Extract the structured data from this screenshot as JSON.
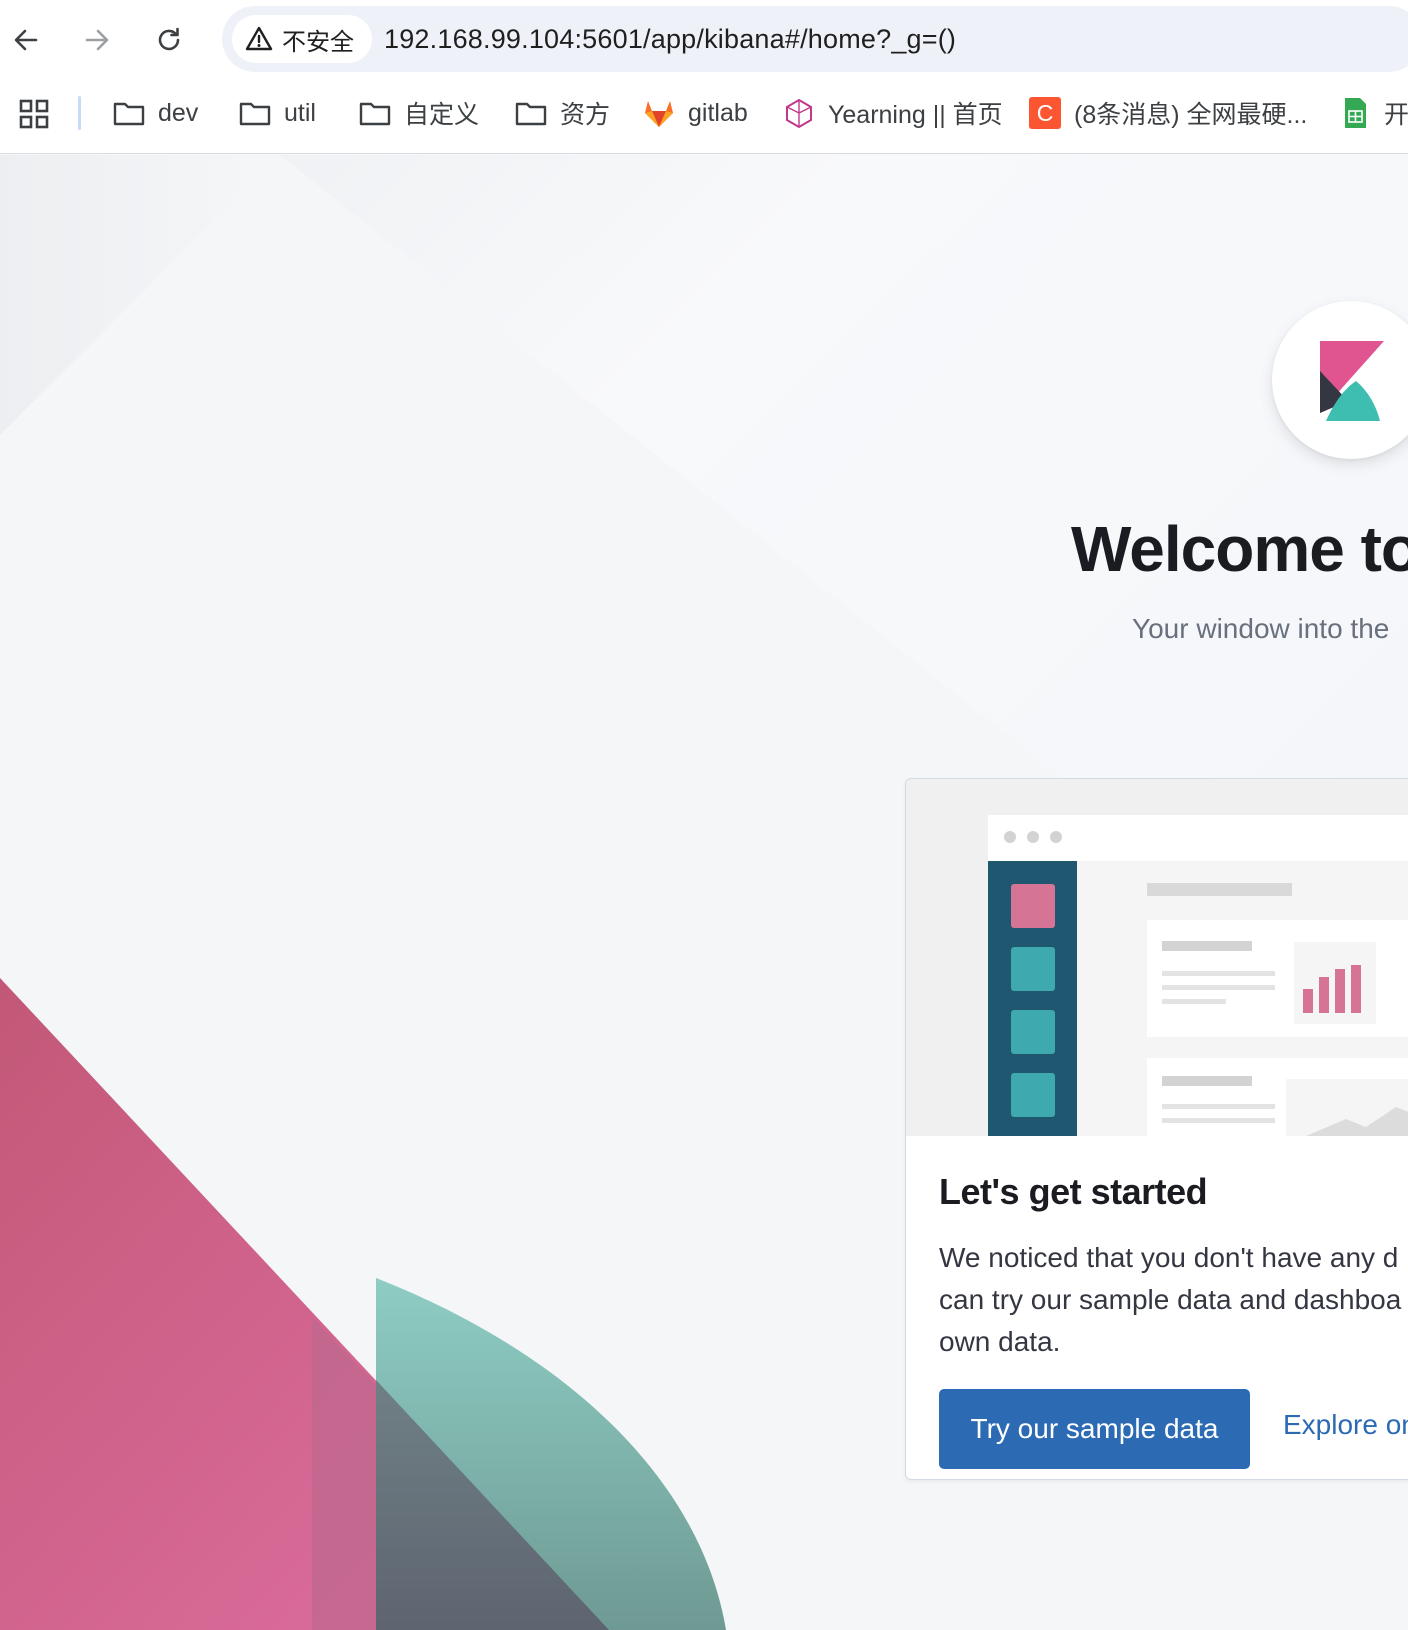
{
  "browser": {
    "security_label": "不安全",
    "url": "192.168.99.104:5601/app/kibana#/home?_g=()",
    "nav_icons": [
      "back-arrow-icon",
      "forward-arrow-icon",
      "reload-icon"
    ]
  },
  "bookmarks": [
    {
      "label": "dev",
      "icon": "folder-icon"
    },
    {
      "label": "util",
      "icon": "folder-icon"
    },
    {
      "label": "自定义",
      "icon": "folder-icon"
    },
    {
      "label": "资方",
      "icon": "folder-icon"
    },
    {
      "label": "gitlab",
      "icon": "gitlab-icon"
    },
    {
      "label": "Yearning || 首页",
      "icon": "yearning-icon"
    },
    {
      "label": "(8条消息) 全网最硬...",
      "icon": "csdn-icon"
    },
    {
      "label": "开",
      "icon": "sheets-icon"
    }
  ],
  "kibana": {
    "welcome_title": "Welcome to",
    "tagline": "Your window into the",
    "colors": {
      "pink": "#e0548f",
      "teal": "#3ebeb0",
      "dark": "#343741",
      "primary": "#2c6bb3"
    }
  },
  "card": {
    "title": "Let's get started",
    "text_lines": [
      "We noticed that you don't have any d",
      "can try our sample data and dashboa",
      "own data."
    ],
    "primary_button": "Try our sample data",
    "link_button": "Explore on"
  }
}
